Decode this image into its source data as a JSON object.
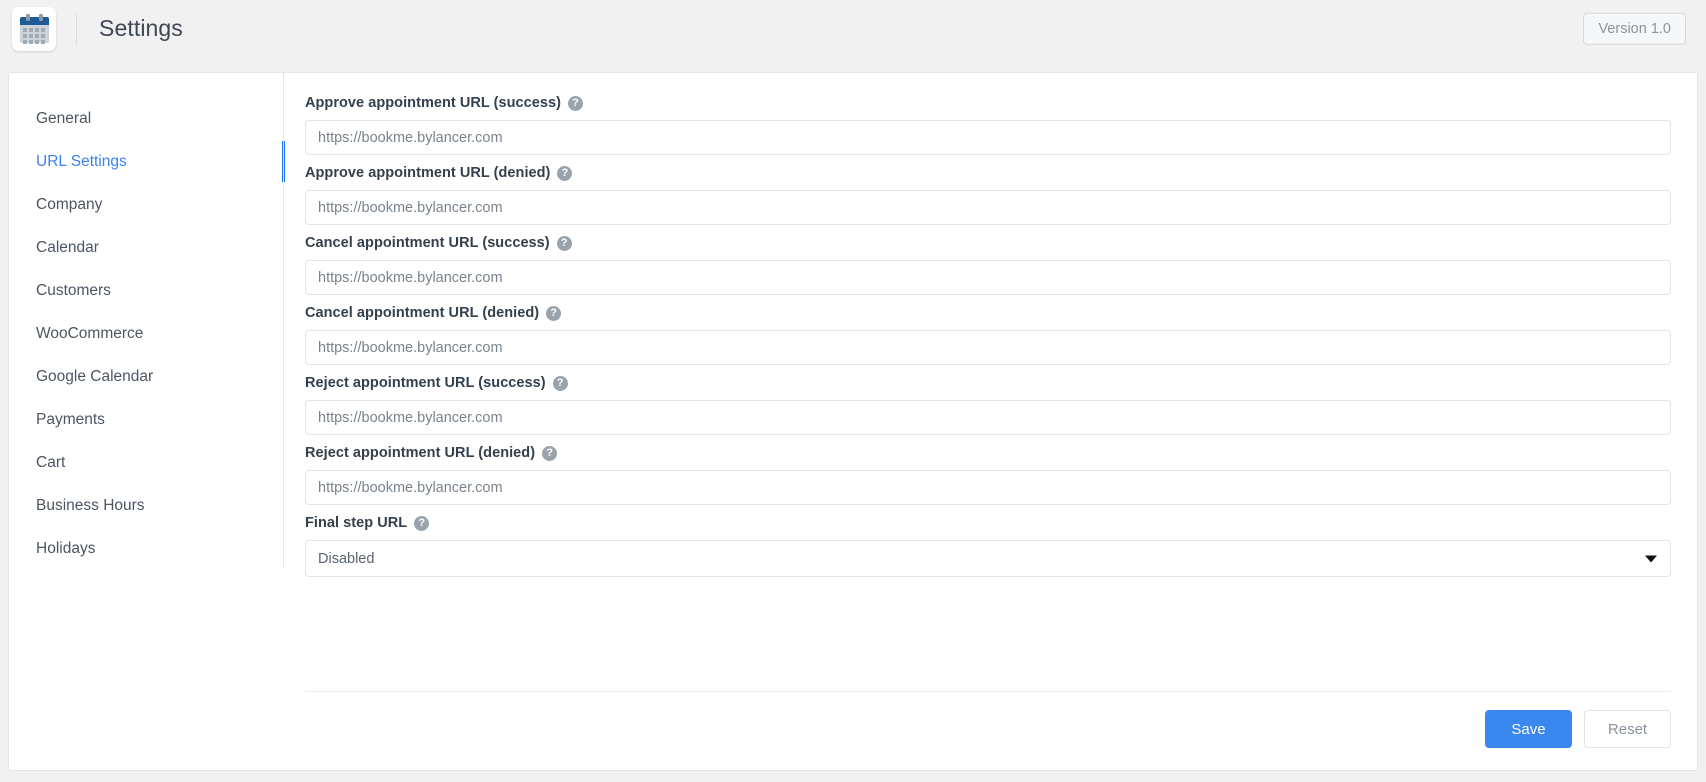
{
  "header": {
    "app_icon": "calendar-icon",
    "title": "Settings",
    "version_badge": "Version 1.0"
  },
  "sidebar": {
    "items": [
      {
        "label": "General",
        "active": false
      },
      {
        "label": "URL Settings",
        "active": true
      },
      {
        "label": "Company",
        "active": false
      },
      {
        "label": "Calendar",
        "active": false
      },
      {
        "label": "Customers",
        "active": false
      },
      {
        "label": "WooCommerce",
        "active": false
      },
      {
        "label": "Google Calendar",
        "active": false
      },
      {
        "label": "Payments",
        "active": false
      },
      {
        "label": "Cart",
        "active": false
      },
      {
        "label": "Business Hours",
        "active": false
      },
      {
        "label": "Holidays",
        "active": false
      }
    ]
  },
  "main": {
    "fields": [
      {
        "label": "Approve appointment URL (success)",
        "help": "?",
        "value": "",
        "placeholder": "https://bookme.bylancer.com"
      },
      {
        "label": "Approve appointment URL (denied)",
        "help": "?",
        "value": "",
        "placeholder": "https://bookme.bylancer.com"
      },
      {
        "label": "Cancel appointment URL (success)",
        "help": "?",
        "value": "",
        "placeholder": "https://bookme.bylancer.com"
      },
      {
        "label": "Cancel appointment URL (denied)",
        "help": "?",
        "value": "",
        "placeholder": "https://bookme.bylancer.com"
      },
      {
        "label": "Reject appointment URL (success)",
        "help": "?",
        "value": "",
        "placeholder": "https://bookme.bylancer.com"
      },
      {
        "label": "Reject appointment URL (denied)",
        "help": "?",
        "value": "",
        "placeholder": "https://bookme.bylancer.com"
      }
    ],
    "final_step": {
      "label": "Final step URL",
      "help": "?",
      "selected": "Disabled"
    }
  },
  "footer": {
    "save_label": "Save",
    "reset_label": "Reset"
  },
  "colors": {
    "accent": "#3b87f0",
    "active_nav": "#3b82f0",
    "active_bar": "#1a73e8",
    "label_text": "#34404d",
    "page_bg": "#f1f1f1",
    "icon_header": "#1f5b96"
  }
}
